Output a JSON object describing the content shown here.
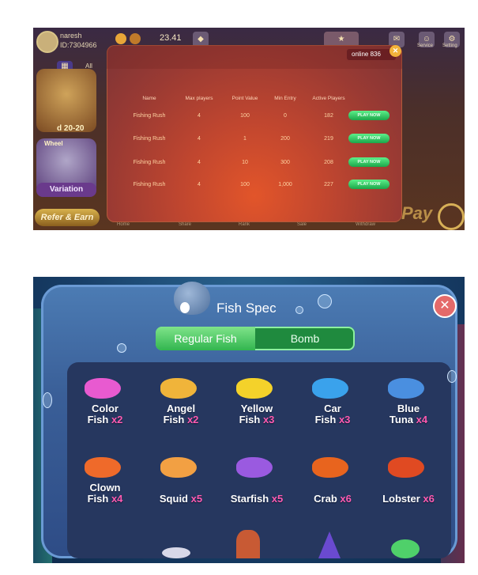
{
  "lobby": {
    "username": "naresh",
    "user_id": "ID:7304966",
    "balance": "23.41",
    "all_label": "All",
    "card_label": "d 20-20",
    "wheel_label": "Wheel",
    "variation_label": "Variation",
    "refer_label": "Refer & Earn",
    "pay_label": "Pay",
    "top_icons": {
      "mail": "Mail",
      "service": "Service",
      "setting": "Setting"
    },
    "tabs": [
      "Home",
      "Share",
      "Rank",
      "Sale",
      "Withdraw"
    ]
  },
  "room_modal": {
    "online_label": "online 836",
    "columns": [
      "Name",
      "Max players",
      "Point Value",
      "Min Entry",
      "Active Players"
    ],
    "rows": [
      {
        "name": "Fishing Rush",
        "max_players": "4",
        "point_value": "100",
        "min_entry": "0",
        "active_players": "182",
        "action": "PLAY NOW"
      },
      {
        "name": "Fishing Rush",
        "max_players": "4",
        "point_value": "1",
        "min_entry": "200",
        "active_players": "219",
        "action": "PLAY NOW"
      },
      {
        "name": "Fishing Rush",
        "max_players": "4",
        "point_value": "10",
        "min_entry": "300",
        "active_players": "208",
        "action": "PLAY NOW"
      },
      {
        "name": "Fishing Rush",
        "max_players": "4",
        "point_value": "100",
        "min_entry": "1,000",
        "active_players": "227",
        "action": "PLAY NOW"
      }
    ]
  },
  "fish_spec": {
    "title": "Fish Spec",
    "tabs": [
      "Regular Fish",
      "Bomb"
    ],
    "fish": [
      {
        "line1": "Color",
        "line2": "Fish",
        "mult": "x2",
        "color": "#e85ad0"
      },
      {
        "line1": "Angel",
        "line2": "Fish",
        "mult": "x2",
        "color": "#f0b43a"
      },
      {
        "line1": "Yellow",
        "line2": "Fish",
        "mult": "x3",
        "color": "#f4d22a"
      },
      {
        "line1": "Car",
        "line2": "Fish",
        "mult": "x3",
        "color": "#3aa2ec"
      },
      {
        "line1": "Blue",
        "line2": "Tuna",
        "mult": "x4",
        "color": "#4a8fe0"
      },
      {
        "line1": "Clown",
        "line2": "Fish",
        "mult": "x4",
        "color": "#ef6a2a"
      },
      {
        "line1": "",
        "line2": "Squid",
        "mult": "x5",
        "color": "#f2a043"
      },
      {
        "line1": "",
        "line2": "Starfish",
        "mult": "x5",
        "color": "#9a5ae0"
      },
      {
        "line1": "",
        "line2": "Crab",
        "mult": "x6",
        "color": "#e8641e"
      },
      {
        "line1": "",
        "line2": "Lobster",
        "mult": "x6",
        "color": "#e04a22"
      }
    ]
  }
}
